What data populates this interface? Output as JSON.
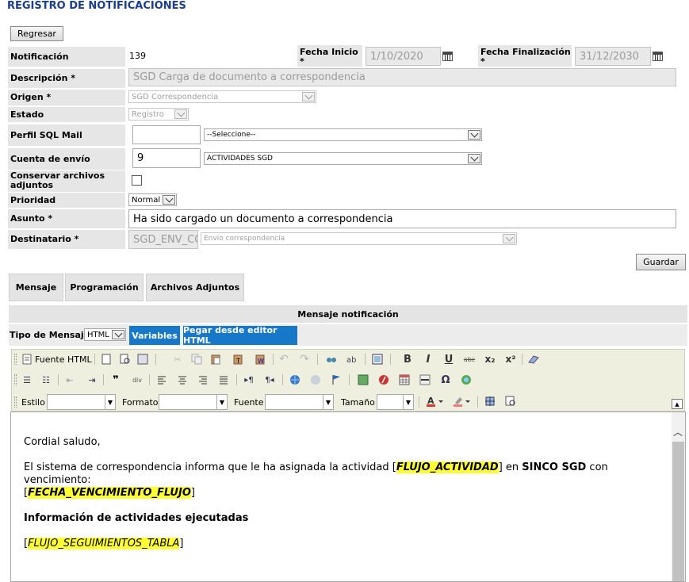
{
  "page_title": "REGISTRO DE NOTIFICACIONES",
  "back_button": "Regresar",
  "save_button": "Guardar",
  "form": {
    "notificacion": {
      "label": "Notificación",
      "value": "139"
    },
    "fecha_inicio": {
      "label": "Fecha Inicio *",
      "value": "1/10/2020"
    },
    "fecha_fin": {
      "label": "Fecha Finalización *",
      "value": "31/12/2030"
    },
    "descripcion": {
      "label": "Descripción *",
      "value": "SGD Carga de documento a correspondencia"
    },
    "origen": {
      "label": "Origen *",
      "value": "SGD Correspondencia"
    },
    "estado": {
      "label": "Estado",
      "value": "Registro"
    },
    "perfil_sql": {
      "label": "Perfil SQL Mail",
      "value": "",
      "select": "--Seleccione--"
    },
    "cuenta_envio": {
      "label": "Cuenta de envío",
      "value": "9",
      "select": "ACTIVIDADES SGD"
    },
    "conservar": {
      "label": "Conservar archivos adjuntos",
      "checked": false
    },
    "prioridad": {
      "label": "Prioridad",
      "value": "Normal"
    },
    "asunto": {
      "label": "Asunto *",
      "value": "Ha sido cargado un documento a correspondencia"
    },
    "destinatario": {
      "label": "Destinatario *",
      "value": "SGD_ENV_CO",
      "select": "Envio correspondencia"
    }
  },
  "tabs": [
    "Mensaje",
    "Programación",
    "Archivos Adjuntos"
  ],
  "section_header": "Mensaje notificación",
  "message_type": {
    "label": "Tipo de Mensaje",
    "value": "HTML"
  },
  "variables_button": "Variables",
  "paste_button": "Pegar desde editor HTML",
  "toolbar": {
    "source_label": "Fuente HTML",
    "estilo": "Estilo",
    "formato": "Formato",
    "fuente": "Fuente",
    "tamano": "Tamaño"
  },
  "editor": {
    "greeting": "Cordial saludo,",
    "p1_start": "El sistema de correspondencia informa que le ha asignada la actividad [",
    "var1": "FLUJO_ACTIVIDAD",
    "p1_mid": "] en ",
    "bold1": "SINCO SGD",
    "p1_end": " con vencimiento:",
    "p2_open": "[",
    "var2": "FECHA_VENCIMIENTO_FLUJO",
    "p2_close": "]",
    "heading": "Información de actividades ejecutadas",
    "p3_open": "[",
    "var3": "FLUJO_SEGUIMIENTOS_TABLA",
    "p3_close": "]"
  },
  "colors": {
    "title": "#1a3d8f",
    "blue_button": "#1778c9",
    "highlight": "#ffff33",
    "toolbar_bg": "#efefdf"
  }
}
